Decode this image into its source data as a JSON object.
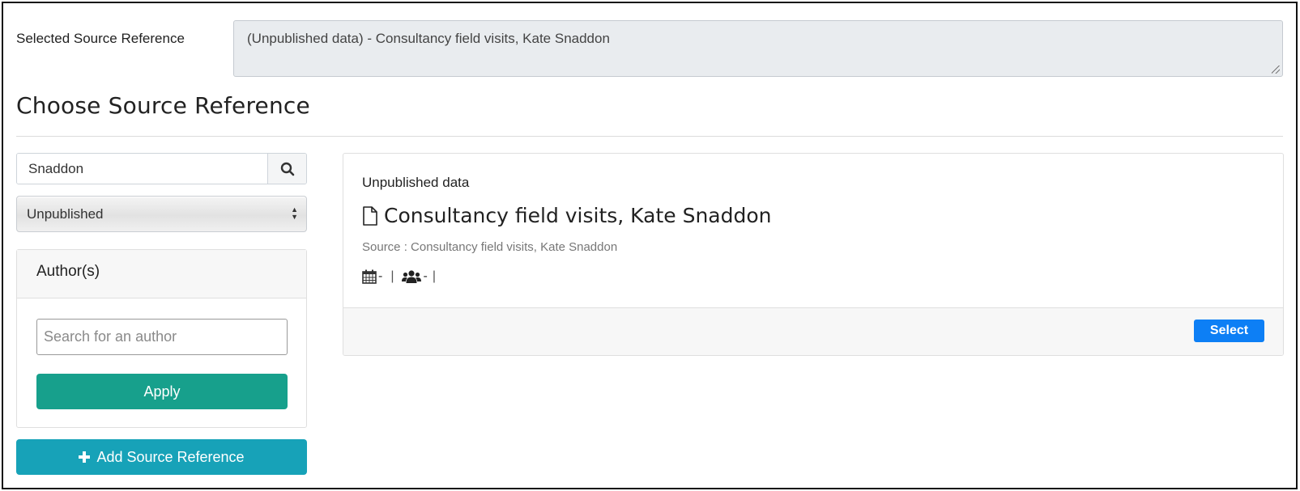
{
  "selected": {
    "label": "Selected Source Reference",
    "value": "(Unpublished data) - Consultancy field visits, Kate Snaddon"
  },
  "page_title": "Choose Source Reference",
  "search": {
    "value": "Snaddon",
    "icon": "search-icon"
  },
  "type_select": {
    "selected": "Unpublished"
  },
  "author_filter": {
    "title": "Author(s)",
    "placeholder": "Search for an author",
    "apply_label": "Apply"
  },
  "add_button": {
    "icon": "plus-icon",
    "label": "Add Source Reference"
  },
  "result": {
    "category": "Unpublished data",
    "title": "Consultancy field visits, Kate Snaddon",
    "source": "Source : Consultancy field visits, Kate Snaddon",
    "date_value": "-",
    "authors_value": "-",
    "select_label": "Select"
  },
  "colors": {
    "apply": "#17a08c",
    "add": "#17a2b8",
    "select": "#0d7ff5",
    "readonly_bg": "#e9ecef"
  }
}
